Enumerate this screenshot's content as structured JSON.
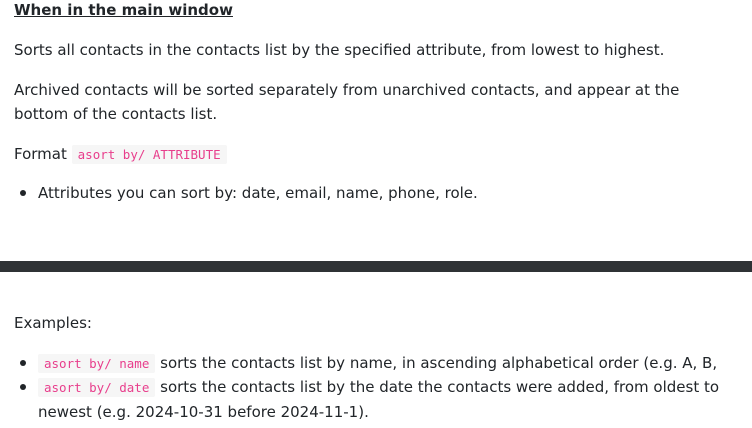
{
  "main_window": {
    "heading": "When in the main window",
    "description": "Sorts all contacts in the contacts list by the specified attribute, from lowest to highest.",
    "archived_note": "Archived contacts will be sorted separately from unarchived contacts, and appear at the bottom of the contacts list.",
    "format_label": "Format",
    "format_code": "asort by/ ATTRIBUTE",
    "attributes_bullet": "Attributes you can sort by: date, email, name, phone, role."
  },
  "examples": {
    "label": "Examples:",
    "items": [
      {
        "code": "asort by/ name",
        "text": "sorts the contacts list by name, in ascending alphabetical order (e.g. A, B, C, ...)."
      },
      {
        "code": "asort by/ date",
        "text": "sorts the contacts list by the date the contacts were added, from oldest to newest (e.g. 2024-10-31 before 2024-11-1)."
      }
    ]
  },
  "colors": {
    "text": "#212529",
    "code_text": "#e83e8c",
    "code_bg": "#f6f6f6",
    "divider": "#2f3235"
  }
}
